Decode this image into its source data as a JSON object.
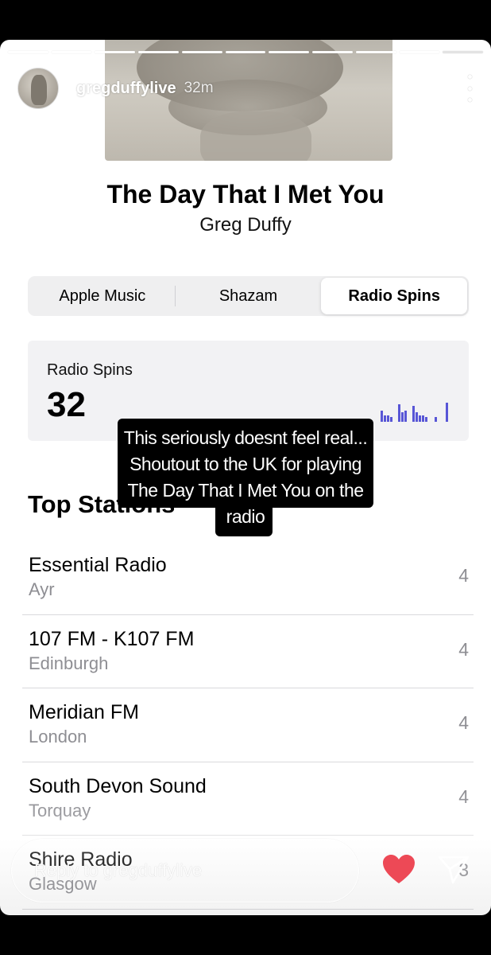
{
  "story": {
    "username": "gregduffylive",
    "time": "32m",
    "segments_total": 11,
    "segments_viewed": 10
  },
  "song": {
    "title": "The Day That I Met You",
    "artist": "Greg Duffy"
  },
  "tabs": [
    {
      "label": "Apple Music",
      "active": false
    },
    {
      "label": "Shazam",
      "active": false
    },
    {
      "label": "Radio Spins",
      "active": true
    }
  ],
  "spins": {
    "label": "Radio Spins",
    "value": "32",
    "spark_color": "#5856d6"
  },
  "caption": {
    "lines": [
      "This seriously doesnt feel real...",
      "Shoutout to the UK for playing",
      "The Day That I Met You on the",
      "radio"
    ]
  },
  "top_stations": {
    "heading": "Top Stations",
    "items": [
      {
        "name": "Essential Radio",
        "city": "Ayr",
        "count": "4"
      },
      {
        "name": "107 FM - K107 FM",
        "city": "Edinburgh",
        "count": "4"
      },
      {
        "name": "Meridian FM",
        "city": "London",
        "count": "4"
      },
      {
        "name": "South Devon Sound",
        "city": "Torquay",
        "count": "4"
      },
      {
        "name": "Shire Radio",
        "city": "Glasgow",
        "count": "3"
      }
    ]
  },
  "reply": {
    "placeholder": "Reply to gregduffylive"
  },
  "colors": {
    "heart": "#ed4956",
    "accent": "#5856d6"
  },
  "icons": {
    "like": "heart-icon",
    "send": "send-icon",
    "more": "more-icon"
  }
}
